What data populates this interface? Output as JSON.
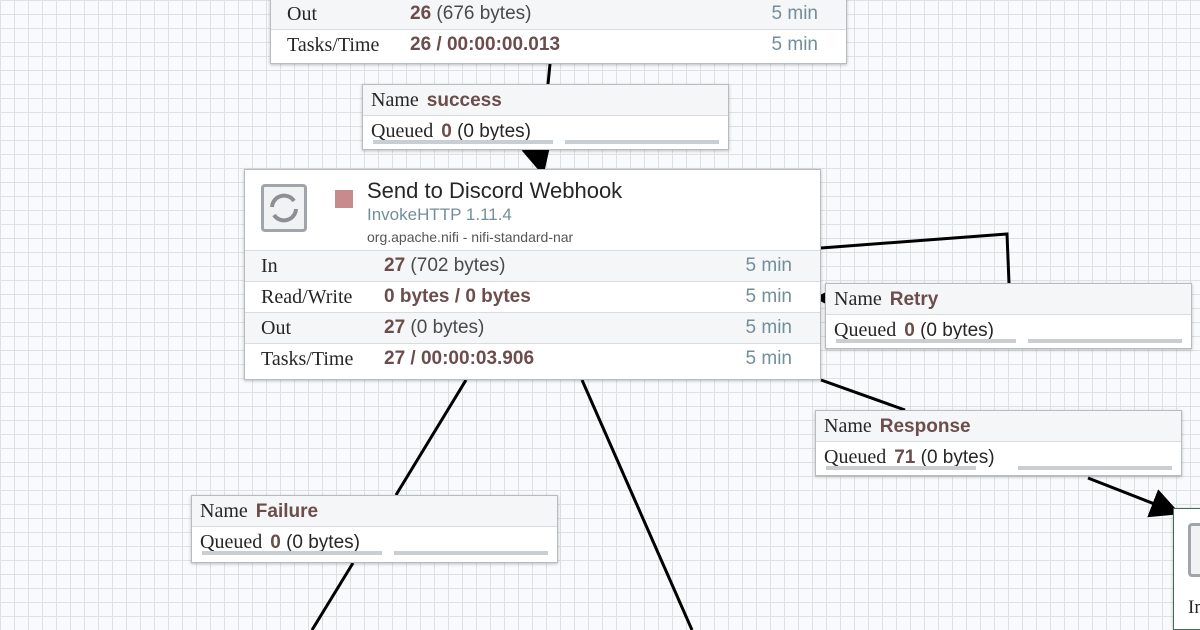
{
  "top_processor": {
    "out_label": "Out",
    "out_count": "26",
    "out_bytes": "(676 bytes)",
    "out_time": "5 min",
    "tasks_label": "Tasks/Time",
    "tasks_value": "26 / 00:00:00.013",
    "tasks_time": "5 min"
  },
  "processor": {
    "name": "Send to Discord Webhook",
    "type": "InvokeHTTP 1.11.4",
    "bundle": "org.apache.nifi - nifi-standard-nar",
    "status_icon": "stop-icon",
    "stats": [
      {
        "label": "In",
        "value": "27",
        "detail": "(702 bytes)",
        "time": "5 min"
      },
      {
        "label": "Read/Write",
        "value": "0 bytes / 0 bytes",
        "detail": "",
        "time": "5 min"
      },
      {
        "label": "Out",
        "value": "27",
        "detail": "(0 bytes)",
        "time": "5 min"
      },
      {
        "label": "Tasks/Time",
        "value": "27 / 00:00:03.906",
        "detail": "",
        "time": "5 min"
      }
    ]
  },
  "connections": {
    "success": {
      "name_label": "Name",
      "name": "success",
      "queued_label": "Queued",
      "queued_count": "0",
      "queued_bytes": "(0 bytes)"
    },
    "retry": {
      "name_label": "Name",
      "name": "Retry",
      "queued_label": "Queued",
      "queued_count": "0",
      "queued_bytes": "(0 bytes)"
    },
    "response": {
      "name_label": "Name",
      "name": "Response",
      "queued_label": "Queued",
      "queued_count": "71",
      "queued_bytes": "(0 bytes)"
    },
    "failure": {
      "name_label": "Name",
      "name": "Failure",
      "queued_label": "Queued",
      "queued_count": "0",
      "queued_bytes": "(0 bytes)"
    }
  },
  "partial_processor": {
    "row_label": "In"
  },
  "colors": {
    "value_accent": "#6d4c4c",
    "time_text": "#728e9b",
    "stopped": "#c78b8d",
    "grid": "#dde1e5"
  }
}
